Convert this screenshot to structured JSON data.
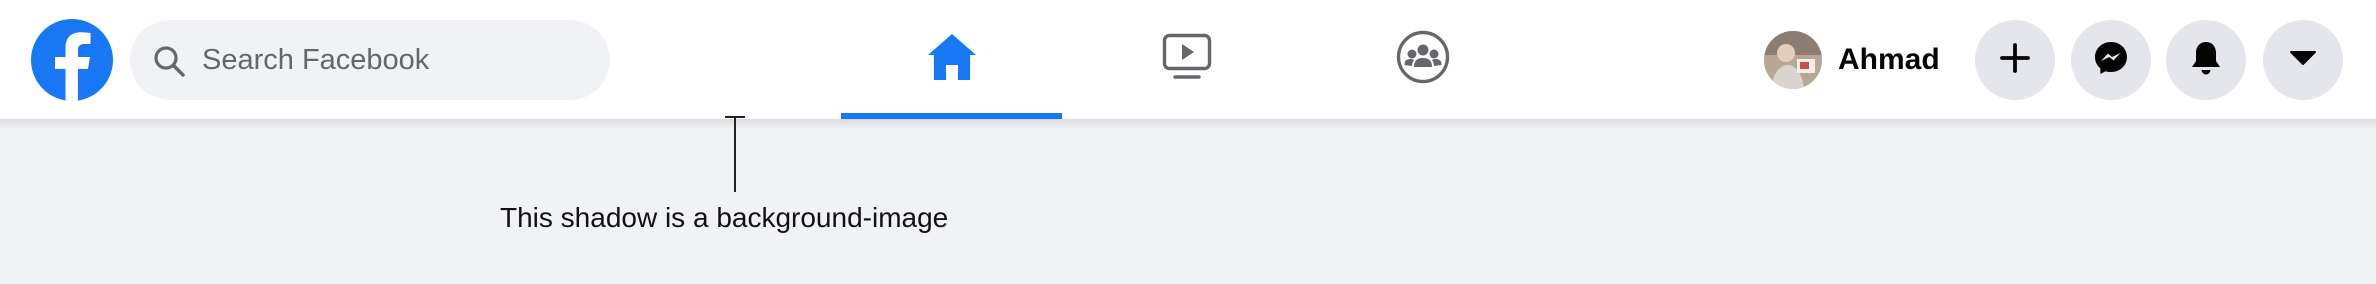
{
  "brand": {
    "logo_icon": "facebook-logo-icon",
    "color": "#1877f2"
  },
  "search": {
    "placeholder": "Search Facebook",
    "value": "",
    "icon": "search-icon"
  },
  "nav": {
    "tabs": [
      {
        "name": "home",
        "icon": "home-icon",
        "active": true
      },
      {
        "name": "watch",
        "icon": "video-icon",
        "active": false
      },
      {
        "name": "groups",
        "icon": "groups-icon",
        "active": false
      }
    ]
  },
  "profile": {
    "name": "Ahmad"
  },
  "actions": [
    {
      "name": "create",
      "icon": "plus-icon"
    },
    {
      "name": "messenger",
      "icon": "messenger-icon"
    },
    {
      "name": "notifications",
      "icon": "bell-icon"
    },
    {
      "name": "account",
      "icon": "caret-down-icon"
    }
  ],
  "annotation": {
    "text": "This shadow is a background-image"
  },
  "colors": {
    "background": "#f0f2f5",
    "button": "#e4e6eb",
    "icon": "#050505",
    "active": "#1877f2",
    "inactive_icon": "#65676b"
  }
}
